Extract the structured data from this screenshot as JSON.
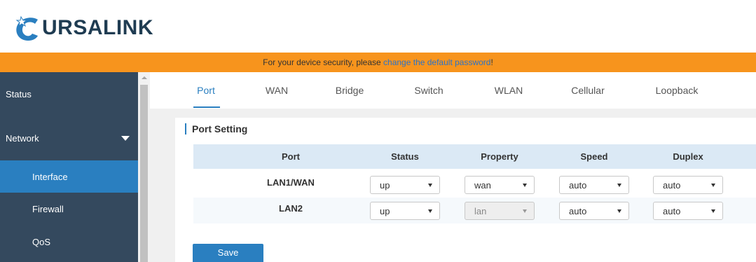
{
  "brand": {
    "name": "URSALINK",
    "accent": "#2a7fc0",
    "notice_bg": "#f7941d",
    "sidebar_bg": "#34495e"
  },
  "notice": {
    "prefix": "For your device security, please ",
    "link": "change the default password",
    "suffix": "!"
  },
  "sidebar": {
    "items": [
      {
        "label": "Status"
      },
      {
        "label": "Network"
      },
      {
        "label": "Interface"
      },
      {
        "label": "Firewall"
      },
      {
        "label": "QoS"
      }
    ]
  },
  "tabs": [
    {
      "label": "Port"
    },
    {
      "label": "WAN"
    },
    {
      "label": "Bridge"
    },
    {
      "label": "Switch"
    },
    {
      "label": "WLAN"
    },
    {
      "label": "Cellular"
    },
    {
      "label": "Loopback"
    }
  ],
  "section": {
    "title": "Port Setting"
  },
  "table": {
    "headers": [
      "Port",
      "Status",
      "Property",
      "Speed",
      "Duplex"
    ],
    "rows": [
      {
        "port": "LAN1/WAN",
        "status": "up",
        "property": "wan",
        "speed": "auto",
        "duplex": "auto"
      },
      {
        "port": "LAN2",
        "status": "up",
        "property": "lan",
        "speed": "auto",
        "duplex": "auto"
      }
    ]
  },
  "actions": {
    "save_label": "Save"
  }
}
